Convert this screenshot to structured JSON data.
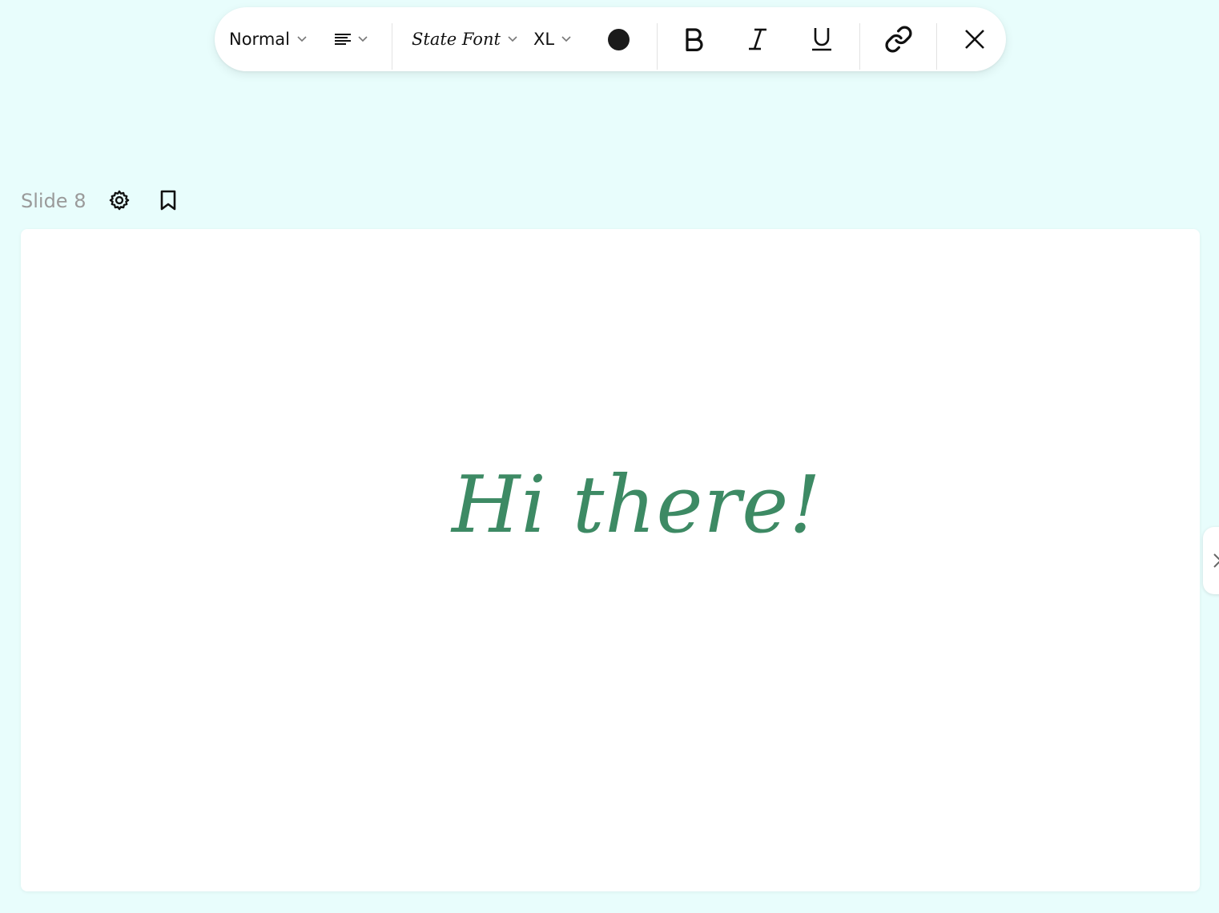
{
  "toolbar": {
    "text_style": "Normal",
    "alignment_icon": "align-left-icon",
    "font_family": "State Font",
    "font_size": "XL",
    "text_color": "#1b1b1b",
    "bold_icon": "bold-icon",
    "italic_icon": "italic-icon",
    "underline_icon": "underline-icon",
    "link_icon": "link-icon",
    "close_icon": "close-icon"
  },
  "slide": {
    "title": "Slide 8",
    "settings_icon": "gear-icon",
    "bookmark_icon": "bookmark-icon",
    "content_text": "Hi there!",
    "content_color": "#3d8a64"
  },
  "navigation": {
    "next_icon": "chevron-right-icon"
  },
  "colors": {
    "background": "#e8fdfc",
    "accent": "#3d8a64"
  }
}
